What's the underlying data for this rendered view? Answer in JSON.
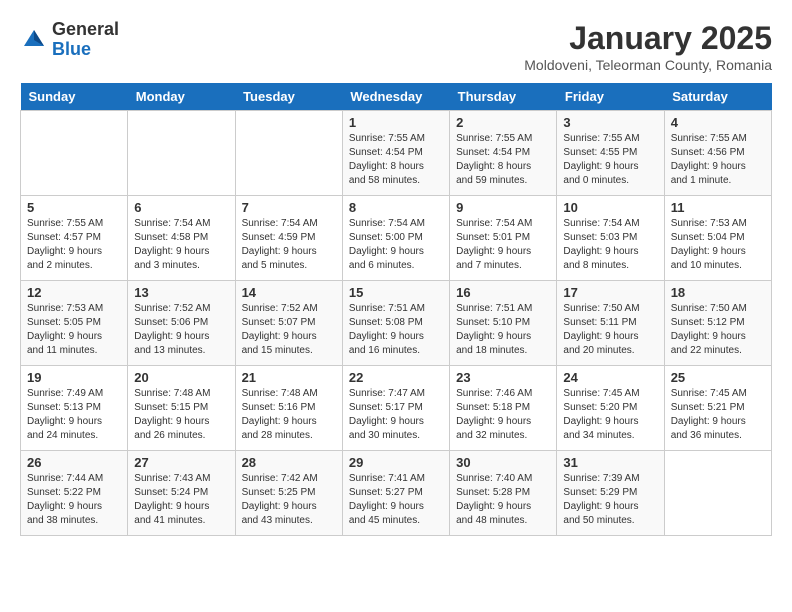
{
  "logo": {
    "general": "General",
    "blue": "Blue"
  },
  "title": "January 2025",
  "location": "Moldoveni, Teleorman County, Romania",
  "weekdays": [
    "Sunday",
    "Monday",
    "Tuesday",
    "Wednesday",
    "Thursday",
    "Friday",
    "Saturday"
  ],
  "weeks": [
    [
      {
        "day": "",
        "info": ""
      },
      {
        "day": "",
        "info": ""
      },
      {
        "day": "",
        "info": ""
      },
      {
        "day": "1",
        "info": "Sunrise: 7:55 AM\nSunset: 4:54 PM\nDaylight: 8 hours\nand 58 minutes."
      },
      {
        "day": "2",
        "info": "Sunrise: 7:55 AM\nSunset: 4:54 PM\nDaylight: 8 hours\nand 59 minutes."
      },
      {
        "day": "3",
        "info": "Sunrise: 7:55 AM\nSunset: 4:55 PM\nDaylight: 9 hours\nand 0 minutes."
      },
      {
        "day": "4",
        "info": "Sunrise: 7:55 AM\nSunset: 4:56 PM\nDaylight: 9 hours\nand 1 minute."
      }
    ],
    [
      {
        "day": "5",
        "info": "Sunrise: 7:55 AM\nSunset: 4:57 PM\nDaylight: 9 hours\nand 2 minutes."
      },
      {
        "day": "6",
        "info": "Sunrise: 7:54 AM\nSunset: 4:58 PM\nDaylight: 9 hours\nand 3 minutes."
      },
      {
        "day": "7",
        "info": "Sunrise: 7:54 AM\nSunset: 4:59 PM\nDaylight: 9 hours\nand 5 minutes."
      },
      {
        "day": "8",
        "info": "Sunrise: 7:54 AM\nSunset: 5:00 PM\nDaylight: 9 hours\nand 6 minutes."
      },
      {
        "day": "9",
        "info": "Sunrise: 7:54 AM\nSunset: 5:01 PM\nDaylight: 9 hours\nand 7 minutes."
      },
      {
        "day": "10",
        "info": "Sunrise: 7:54 AM\nSunset: 5:03 PM\nDaylight: 9 hours\nand 8 minutes."
      },
      {
        "day": "11",
        "info": "Sunrise: 7:53 AM\nSunset: 5:04 PM\nDaylight: 9 hours\nand 10 minutes."
      }
    ],
    [
      {
        "day": "12",
        "info": "Sunrise: 7:53 AM\nSunset: 5:05 PM\nDaylight: 9 hours\nand 11 minutes."
      },
      {
        "day": "13",
        "info": "Sunrise: 7:52 AM\nSunset: 5:06 PM\nDaylight: 9 hours\nand 13 minutes."
      },
      {
        "day": "14",
        "info": "Sunrise: 7:52 AM\nSunset: 5:07 PM\nDaylight: 9 hours\nand 15 minutes."
      },
      {
        "day": "15",
        "info": "Sunrise: 7:51 AM\nSunset: 5:08 PM\nDaylight: 9 hours\nand 16 minutes."
      },
      {
        "day": "16",
        "info": "Sunrise: 7:51 AM\nSunset: 5:10 PM\nDaylight: 9 hours\nand 18 minutes."
      },
      {
        "day": "17",
        "info": "Sunrise: 7:50 AM\nSunset: 5:11 PM\nDaylight: 9 hours\nand 20 minutes."
      },
      {
        "day": "18",
        "info": "Sunrise: 7:50 AM\nSunset: 5:12 PM\nDaylight: 9 hours\nand 22 minutes."
      }
    ],
    [
      {
        "day": "19",
        "info": "Sunrise: 7:49 AM\nSunset: 5:13 PM\nDaylight: 9 hours\nand 24 minutes."
      },
      {
        "day": "20",
        "info": "Sunrise: 7:48 AM\nSunset: 5:15 PM\nDaylight: 9 hours\nand 26 minutes."
      },
      {
        "day": "21",
        "info": "Sunrise: 7:48 AM\nSunset: 5:16 PM\nDaylight: 9 hours\nand 28 minutes."
      },
      {
        "day": "22",
        "info": "Sunrise: 7:47 AM\nSunset: 5:17 PM\nDaylight: 9 hours\nand 30 minutes."
      },
      {
        "day": "23",
        "info": "Sunrise: 7:46 AM\nSunset: 5:18 PM\nDaylight: 9 hours\nand 32 minutes."
      },
      {
        "day": "24",
        "info": "Sunrise: 7:45 AM\nSunset: 5:20 PM\nDaylight: 9 hours\nand 34 minutes."
      },
      {
        "day": "25",
        "info": "Sunrise: 7:45 AM\nSunset: 5:21 PM\nDaylight: 9 hours\nand 36 minutes."
      }
    ],
    [
      {
        "day": "26",
        "info": "Sunrise: 7:44 AM\nSunset: 5:22 PM\nDaylight: 9 hours\nand 38 minutes."
      },
      {
        "day": "27",
        "info": "Sunrise: 7:43 AM\nSunset: 5:24 PM\nDaylight: 9 hours\nand 41 minutes."
      },
      {
        "day": "28",
        "info": "Sunrise: 7:42 AM\nSunset: 5:25 PM\nDaylight: 9 hours\nand 43 minutes."
      },
      {
        "day": "29",
        "info": "Sunrise: 7:41 AM\nSunset: 5:27 PM\nDaylight: 9 hours\nand 45 minutes."
      },
      {
        "day": "30",
        "info": "Sunrise: 7:40 AM\nSunset: 5:28 PM\nDaylight: 9 hours\nand 48 minutes."
      },
      {
        "day": "31",
        "info": "Sunrise: 7:39 AM\nSunset: 5:29 PM\nDaylight: 9 hours\nand 50 minutes."
      },
      {
        "day": "",
        "info": ""
      }
    ]
  ]
}
